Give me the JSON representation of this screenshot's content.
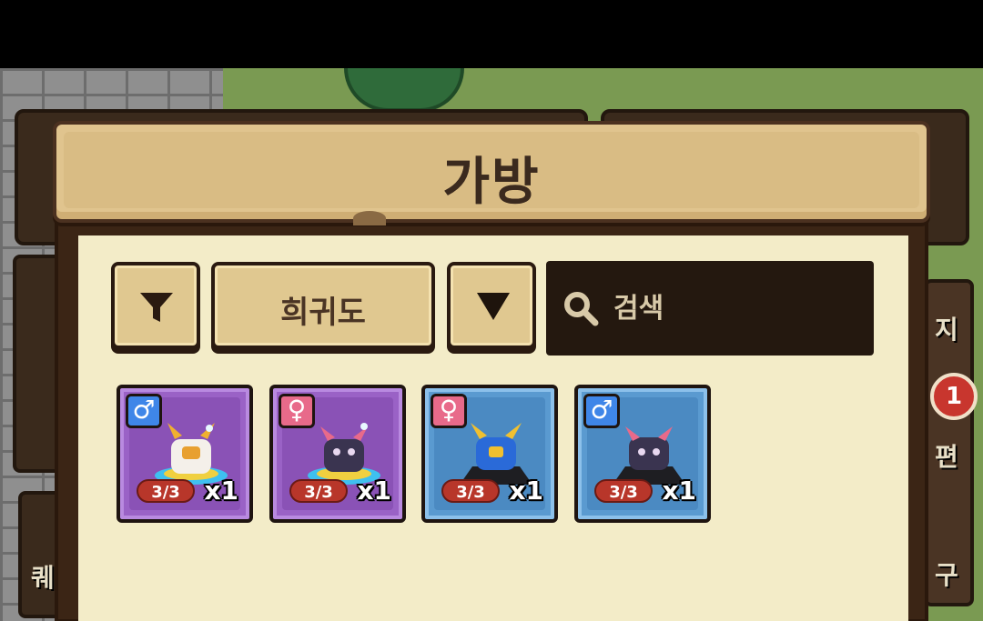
{
  "title": "가방",
  "controls": {
    "sort_label": "희귀도",
    "search_placeholder": "검색"
  },
  "items": [
    {
      "gender_symbol": "♂",
      "gender": "male",
      "rarity": "epic",
      "level": "3/3",
      "count": "x1",
      "icon": "white-gold-monster-icon"
    },
    {
      "gender_symbol": "♀",
      "gender": "female",
      "rarity": "epic",
      "level": "3/3",
      "count": "x1",
      "icon": "dark-horned-monster-icon"
    },
    {
      "gender_symbol": "♀",
      "gender": "female",
      "rarity": "rare",
      "level": "3/3",
      "count": "x1",
      "icon": "blue-gold-monster-icon"
    },
    {
      "gender_symbol": "♂",
      "gender": "male",
      "rarity": "rare",
      "level": "3/3",
      "count": "x1",
      "icon": "dark-horned-monster-icon"
    }
  ],
  "background": {
    "right_label_1": "지",
    "right_label_2": "편",
    "right_label_3": "구",
    "left_label": "퀘",
    "notification_count": "1"
  },
  "colors": {
    "epic": "#9a62c6",
    "rare": "#5a9ad0",
    "male": "#3f86e8",
    "female": "#e86a8a",
    "panel_bg": "#f3ecc8",
    "title_bg": "#e0c48e"
  }
}
